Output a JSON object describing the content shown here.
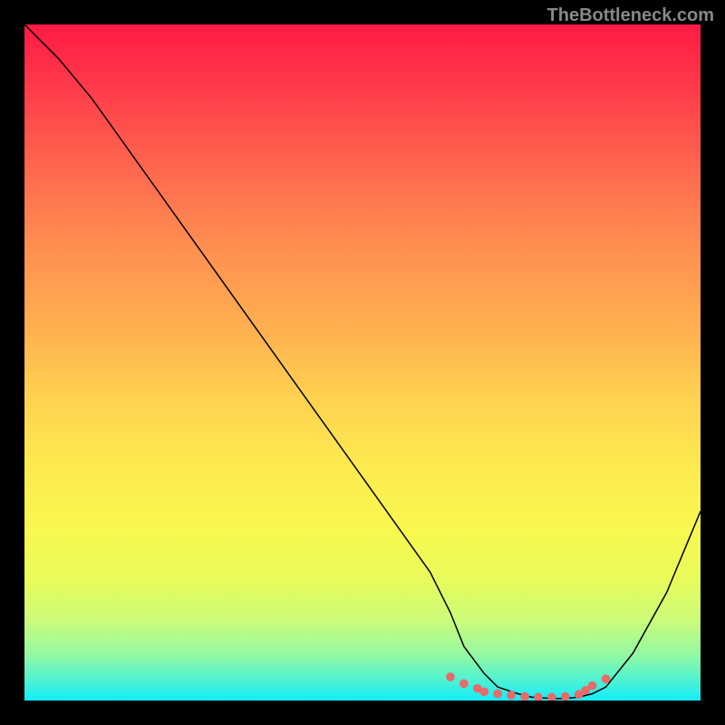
{
  "watermark": "TheBottleneck.com",
  "chart_data": {
    "type": "line",
    "title": "",
    "xlabel": "",
    "ylabel": "",
    "xlim": [
      0,
      100
    ],
    "ylim": [
      0,
      100
    ],
    "series": [
      {
        "name": "curve",
        "x": [
          0,
          5,
          10,
          15,
          20,
          25,
          30,
          35,
          40,
          45,
          50,
          55,
          60,
          63,
          65,
          68,
          70,
          73,
          75,
          78,
          80,
          82,
          84,
          86,
          90,
          95,
          100
        ],
        "y": [
          100,
          95,
          89,
          82,
          75,
          68,
          61,
          54,
          47,
          40,
          33,
          26,
          19,
          13,
          8,
          4,
          2,
          1,
          0.5,
          0.3,
          0.3,
          0.5,
          1,
          2,
          7,
          16,
          28
        ]
      }
    ],
    "markers": {
      "name": "highlight-dots",
      "color": "#e86a6a",
      "x": [
        63,
        65,
        67,
        68,
        70,
        72,
        74,
        76,
        78,
        80,
        82,
        83,
        84,
        86
      ],
      "y": [
        3.5,
        2.5,
        1.8,
        1.3,
        1.0,
        0.8,
        0.6,
        0.5,
        0.5,
        0.6,
        0.9,
        1.5,
        2.2,
        3.2
      ]
    },
    "gradient_colors": [
      "#ff1a44",
      "#ffd150",
      "#f8f84e",
      "#12edfa"
    ]
  }
}
